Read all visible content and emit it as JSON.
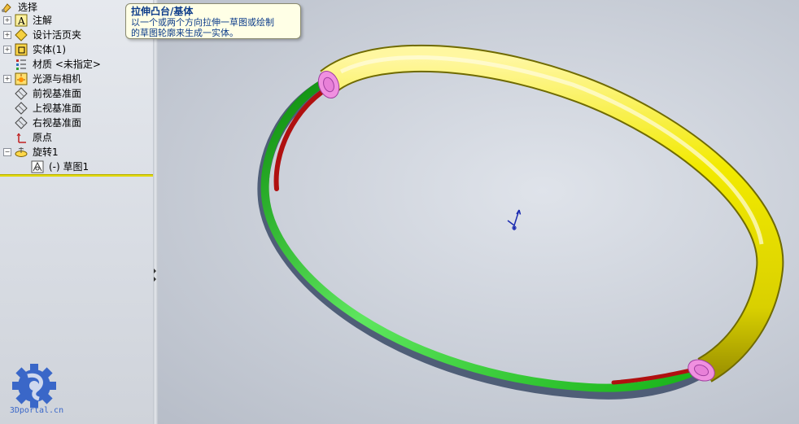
{
  "tree": {
    "items": [
      {
        "label": "选择",
        "icon": "selection-icon"
      },
      {
        "label": "注解",
        "icon": "annotations-icon"
      },
      {
        "label": "设计活页夹",
        "icon": "design-binder-icon"
      },
      {
        "label": "实体(1)",
        "icon": "solid-bodies-icon"
      },
      {
        "label": "材质 <未指定>",
        "icon": "material-icon"
      },
      {
        "label": "光源与相机",
        "icon": "lights-cameras-icon"
      },
      {
        "label": "前视基准面",
        "icon": "plane-icon"
      },
      {
        "label": "上视基准面",
        "icon": "plane-icon"
      },
      {
        "label": "右视基准面",
        "icon": "plane-icon"
      },
      {
        "label": "原点",
        "icon": "origin-icon"
      },
      {
        "label": "旋转1",
        "icon": "revolve-icon"
      },
      {
        "label": "(-) 草图1",
        "icon": "sketch-icon"
      }
    ]
  },
  "tooltip": {
    "title": "拉伸凸台/基体",
    "line1": "以一个或两个方向拉伸一草图或绘制",
    "line2": "的草图轮廓来生成一实体。"
  },
  "watermark": {
    "text": "3Dportal.cn"
  },
  "colors": {
    "tube": "#f2ea00",
    "section_face": "#f090e0",
    "cut_inner": "#1ec81e",
    "cut_red": "#b01010",
    "accent": "#e0d800"
  }
}
